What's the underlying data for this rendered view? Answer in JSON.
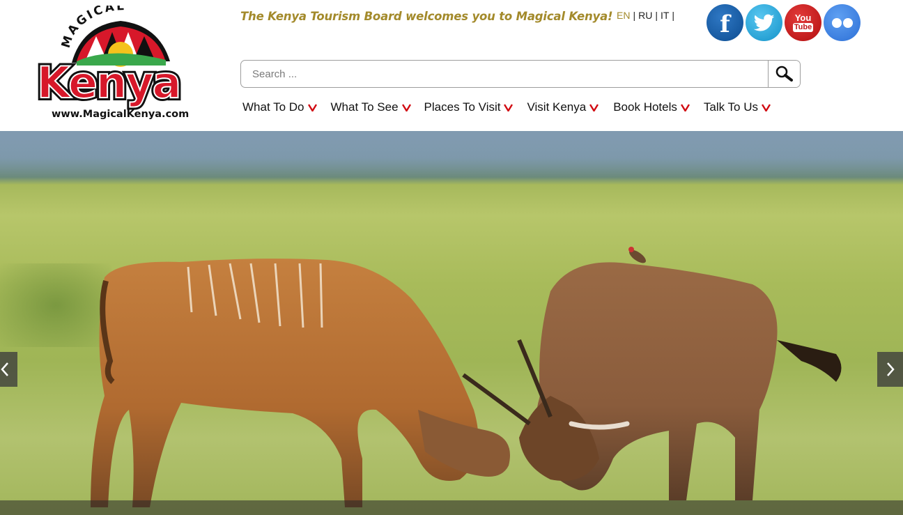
{
  "logo": {
    "arc_text": "MAGICAL",
    "main_text": "Kenya",
    "url_text": "www.MagicalKenya.com"
  },
  "header": {
    "tagline": "The Kenya Tourism Board welcomes you to Magical Kenya!"
  },
  "languages": [
    {
      "label": "EN",
      "active": true
    },
    {
      "label": "RU",
      "active": false
    },
    {
      "label": "IT",
      "active": false
    }
  ],
  "language_separator": "|",
  "social": {
    "facebook_icon": "facebook-icon",
    "twitter_icon": "twitter-icon",
    "youtube": {
      "top": "You",
      "bottom": "Tube"
    },
    "flickr_icon": "flickr-icon"
  },
  "search": {
    "placeholder": "Search ...",
    "value": "",
    "button_icon": "search-icon"
  },
  "nav": [
    {
      "label": "What To Do"
    },
    {
      "label": "What To See"
    },
    {
      "label": "Places To Visit"
    },
    {
      "label": "Visit Kenya"
    },
    {
      "label": "Book Hotels"
    },
    {
      "label": "Talk To Us"
    }
  ],
  "colors": {
    "accent_gold": "#a38a2b",
    "kenya_red": "#d7182a",
    "caret_red": "#d10a11",
    "facebook": "#0c4c91",
    "twitter": "#1493c9",
    "youtube": "#c1161a",
    "flickr": "#2c6fd6"
  },
  "hero": {
    "image_subject": "two-eland-antelopes-sparring-on-grassland",
    "prev_icon": "chevron-left-icon",
    "next_icon": "chevron-right-icon"
  }
}
